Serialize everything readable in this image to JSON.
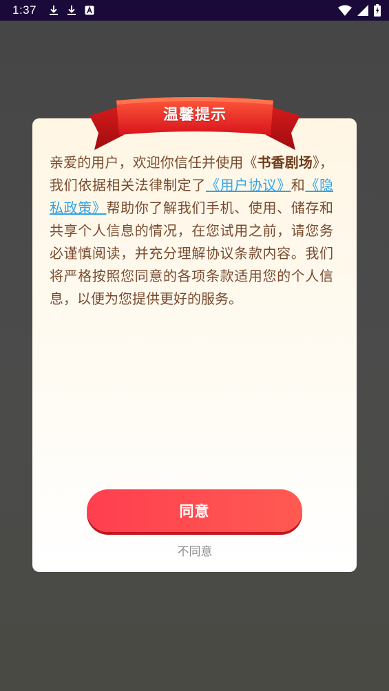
{
  "status_bar": {
    "time": "1:37",
    "left_icons": [
      "download-icon",
      "download-icon",
      "a-notification-icon"
    ],
    "right_icons": [
      "wifi-icon",
      "signal-icon",
      "battery-icon"
    ]
  },
  "dialog": {
    "title": "温馨提示",
    "body": {
      "p1": "亲爱的用户，欢迎你信任并使用《",
      "app_name": "书香剧场",
      "p2": "》，我们依据相关法律制定了",
      "link_agreement": "《用户协议》",
      "p3": "和",
      "link_privacy": "《隐私政策》",
      "p4": "帮助你了解我们手机、使用、储存和共享个人信息的情况，在您试用之前，请您务必谨慎阅读，并充分理解协议条款内容。我们将严格按照您同意的各项条款适用您的个人信息，以便为您提供更好的服务。"
    },
    "agree_label": "同意",
    "disagree_label": "不同意"
  },
  "colors": {
    "accent": "#ff4a50",
    "link": "#33a3e8",
    "body_text": "#7a4a2e",
    "status_bar": "#1a0a3a"
  }
}
